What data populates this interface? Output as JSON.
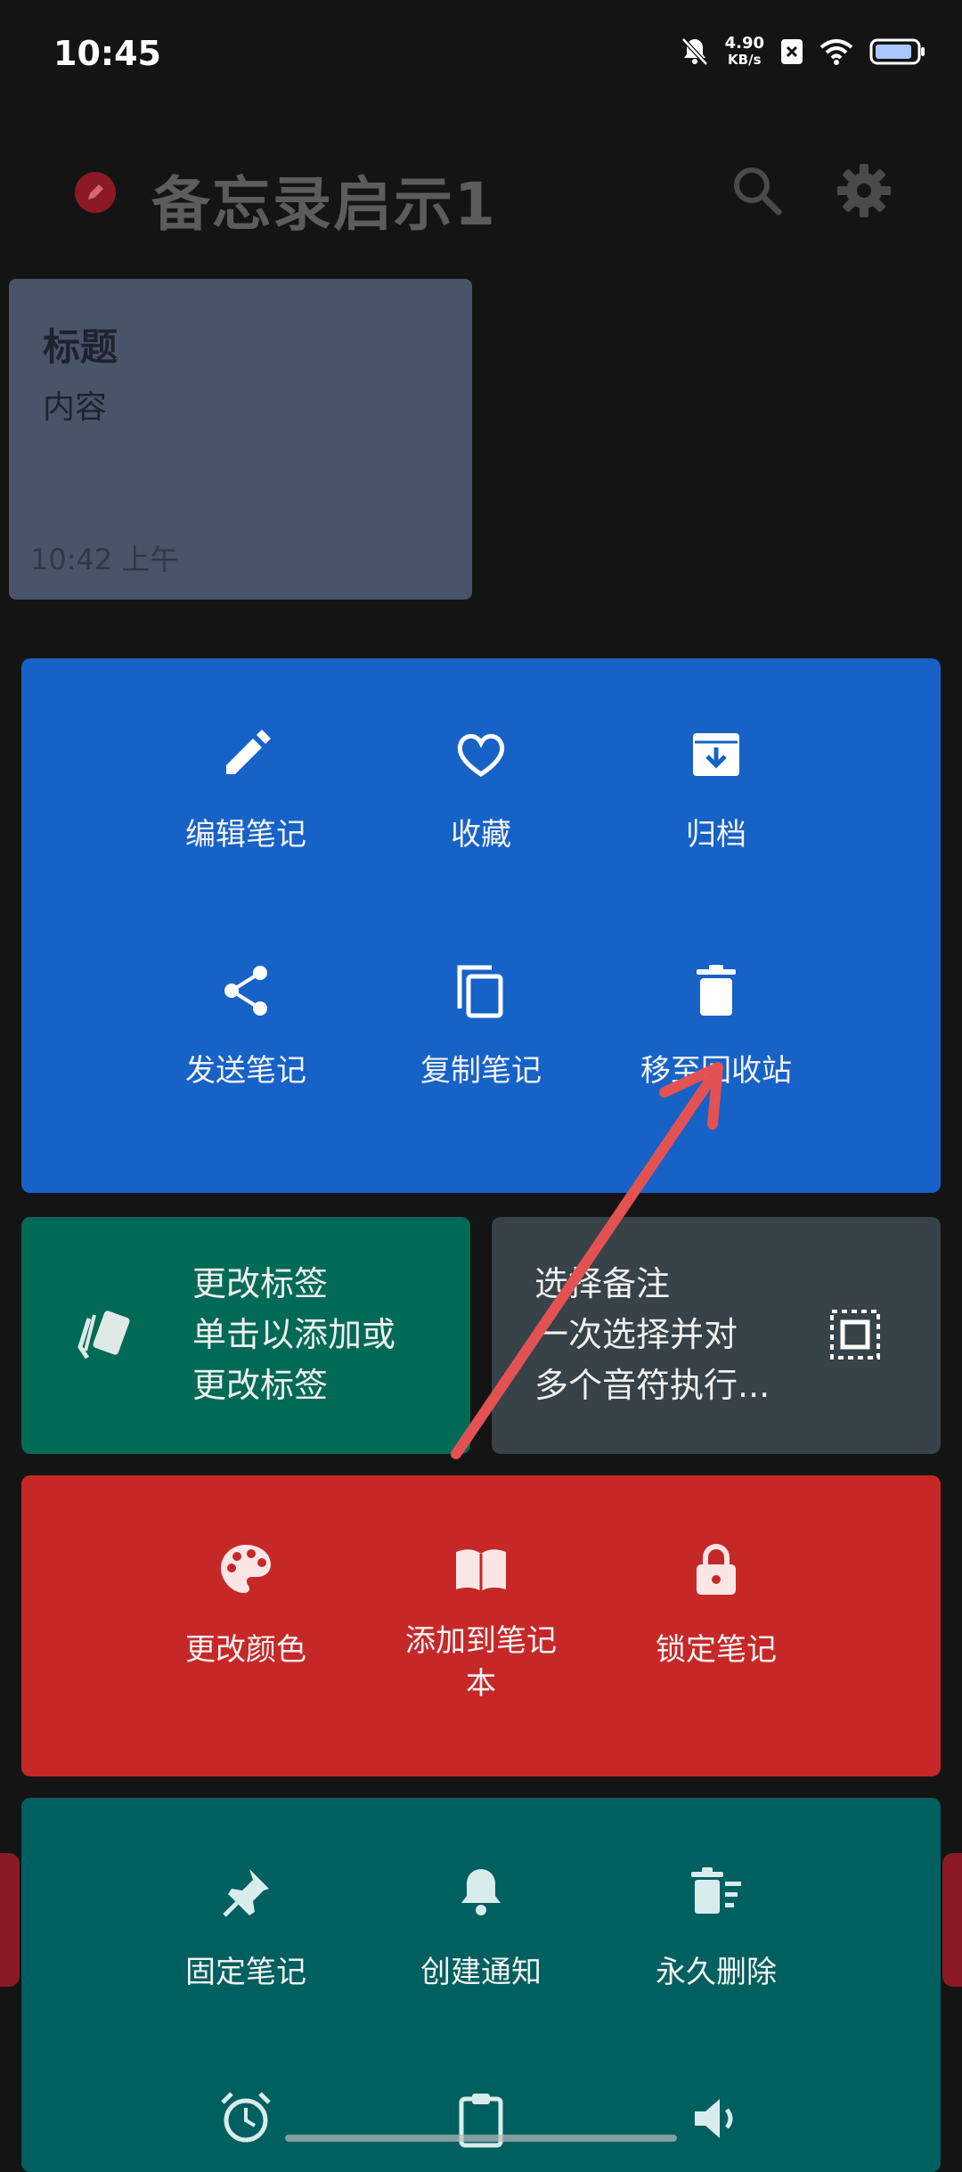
{
  "status_bar": {
    "time": "10:45",
    "net_speed_value": "4.90",
    "net_speed_unit": "KB/s",
    "icons": [
      "mute-icon",
      "sim-x-icon",
      "wifi-icon",
      "battery-icon"
    ]
  },
  "app_bar": {
    "title": "备忘录启示1",
    "icons": [
      "edit-logo-icon",
      "search-icon",
      "settings-icon"
    ]
  },
  "note": {
    "title": "标题",
    "content": "内容",
    "time": "10:42 上午"
  },
  "actions_primary": [
    {
      "label": "编辑笔记",
      "icon": "pencil-icon"
    },
    {
      "label": "收藏",
      "icon": "heart-icon"
    },
    {
      "label": "归档",
      "icon": "archive-icon"
    },
    {
      "label": "发送笔记",
      "icon": "share-icon"
    },
    {
      "label": "复制笔记",
      "icon": "copy-icon"
    },
    {
      "label": "移至回收站",
      "icon": "trash-icon"
    }
  ],
  "tags_card": {
    "title": "更改标签",
    "desc_line1": "单击以添加或",
    "desc_line2": "更改标签",
    "icon": "tag-icon"
  },
  "select_card": {
    "title": "选择备注",
    "desc_line1": "一次选择并对",
    "desc_line2": "多个音符执行...",
    "icon": "select-all-icon"
  },
  "actions_red": [
    {
      "label": "更改颜色",
      "icon": "palette-icon"
    },
    {
      "label_line1": "添加到笔记",
      "label_line2": "本",
      "icon": "book-icon"
    },
    {
      "label": "锁定笔记",
      "icon": "lock-icon"
    }
  ],
  "actions_teal": [
    {
      "label": "固定笔记",
      "icon": "pin-icon"
    },
    {
      "label": "创建通知",
      "icon": "bell-icon"
    },
    {
      "label": "永久删除",
      "icon": "delete-forever-icon"
    }
  ],
  "actions_teal_partial": [
    "alarm-icon",
    "clipboard-icon",
    "volume-icon"
  ],
  "overlay": {
    "annotation": "arrow-annotation",
    "color": "#e35252"
  },
  "colors": {
    "background": "#141414",
    "primary_panel": "#1762c7",
    "tag_panel": "#006a57",
    "select_panel": "#374249",
    "red_panel": "#c62828",
    "teal_panel": "#005f5f",
    "note_card": "#4a5468"
  }
}
